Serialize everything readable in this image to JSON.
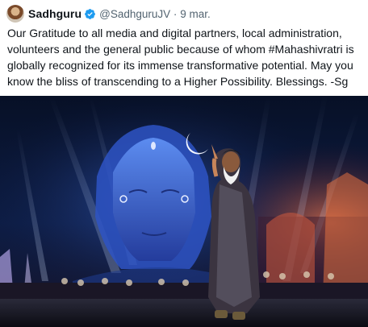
{
  "tweet": {
    "author_name": "Sadhguru",
    "handle": "@SadhguruJV",
    "separator": "·",
    "date": "9 mar.",
    "text": "Our Gratitude to all media and digital partners, local administration, volunteers and the general public because of whom #Mahashivratri is globally recognized for its immense transformative potential. May you know the bliss of transcending to a Higher Possibility. Blessings. -Sg"
  },
  "icons": {
    "verified": "verified-badge-icon",
    "avatar": "profile-avatar"
  },
  "colors": {
    "verified_blue": "#1d9bf0",
    "secondary_text": "#536471",
    "primary_text": "#0f1419"
  }
}
